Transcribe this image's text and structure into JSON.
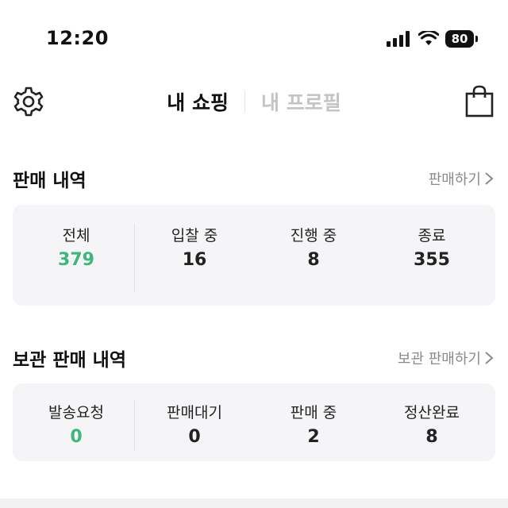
{
  "status_bar": {
    "time": "12:20",
    "battery": "80"
  },
  "nav": {
    "tabs": [
      {
        "label": "내 쇼핑",
        "active": true
      },
      {
        "label": "내 프로필",
        "active": false
      }
    ]
  },
  "sales": {
    "title": "판매 내역",
    "link": "판매하기",
    "stats": [
      {
        "label": "전체",
        "value": "379"
      },
      {
        "label": "입찰 중",
        "value": "16"
      },
      {
        "label": "진행 중",
        "value": "8"
      },
      {
        "label": "종료",
        "value": "355"
      }
    ]
  },
  "storage_sales": {
    "title": "보관 판매 내역",
    "link": "보관 판매하기",
    "stats": [
      {
        "label": "발송요청",
        "value": "0"
      },
      {
        "label": "판매대기",
        "value": "0"
      },
      {
        "label": "판매 중",
        "value": "2"
      },
      {
        "label": "정산완료",
        "value": "8"
      }
    ]
  },
  "colors": {
    "accent": "#3cb67a",
    "card_bg": "#f5f5f7",
    "muted": "#8a8a8a"
  }
}
